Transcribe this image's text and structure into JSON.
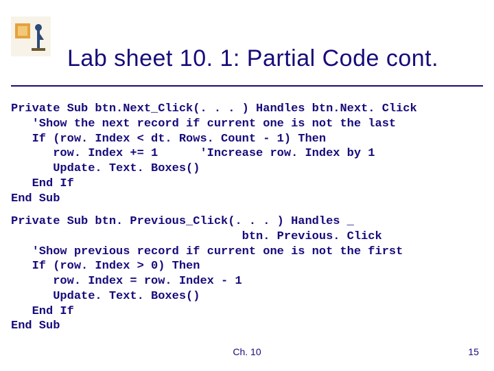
{
  "title": "Lab sheet 10. 1: Partial Code cont.",
  "code1": "Private Sub btn.Next_Click(. . . ) Handles btn.Next. Click\n   'Show the next record if current one is not the last\n   If (row. Index < dt. Rows. Count - 1) Then\n      row. Index += 1      'Increase row. Index by 1\n      Update. Text. Boxes()\n   End If\nEnd Sub",
  "code2": "Private Sub btn. Previous_Click(. . . ) Handles _\n                                 btn. Previous. Click\n   'Show previous record if current one is not the first\n   If (row. Index > 0) Then\n      row. Index = row. Index - 1\n      Update. Text. Boxes()\n   End If\nEnd Sub",
  "footer": {
    "chapter": "Ch. 10",
    "page": "15"
  },
  "logo": {
    "name": "slide-logo"
  }
}
